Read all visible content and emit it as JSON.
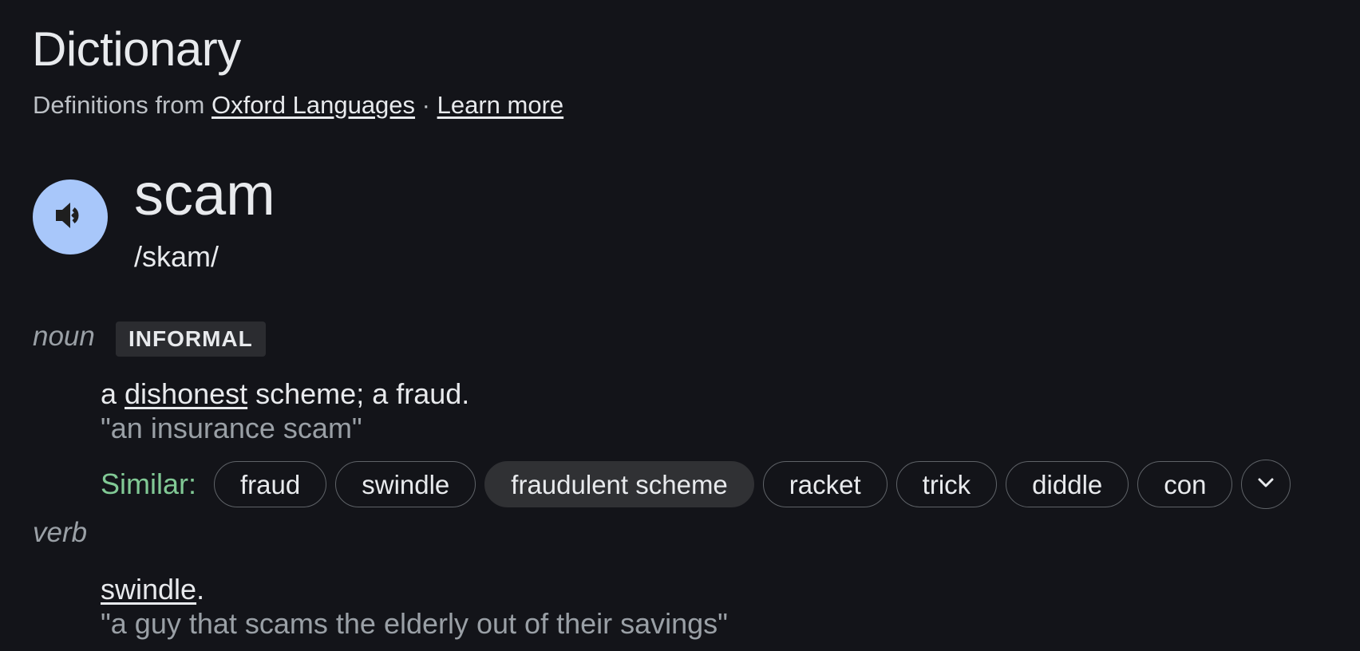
{
  "header": {
    "title": "Dictionary",
    "source_prefix": "Definitions from ",
    "source_link": "Oxford Languages",
    "separator": " · ",
    "learn_more": "Learn more"
  },
  "entry": {
    "word": "scam",
    "phonetic": "/skam/",
    "speaker_icon": "volume-icon",
    "accent_color": "#a8c7fa"
  },
  "noun": {
    "pos": "noun",
    "tag": "INFORMAL",
    "def_prefix": "a ",
    "def_link": "dishonest",
    "def_suffix": " scheme; a fraud.",
    "example": "\"an insurance scam\"",
    "similar_label": "Similar:",
    "similar": [
      "fraud",
      "swindle",
      "fraudulent scheme",
      "racket",
      "trick",
      "diddle",
      "con"
    ],
    "expand_icon": "chevron-down-icon"
  },
  "verb": {
    "pos": "verb",
    "def_link": "swindle",
    "def_suffix": ".",
    "example": "\"a guy that scams the elderly out of their savings\""
  },
  "colors": {
    "background": "#131419",
    "similar_label": "#81c995",
    "muted_text": "#9aa0a6"
  }
}
